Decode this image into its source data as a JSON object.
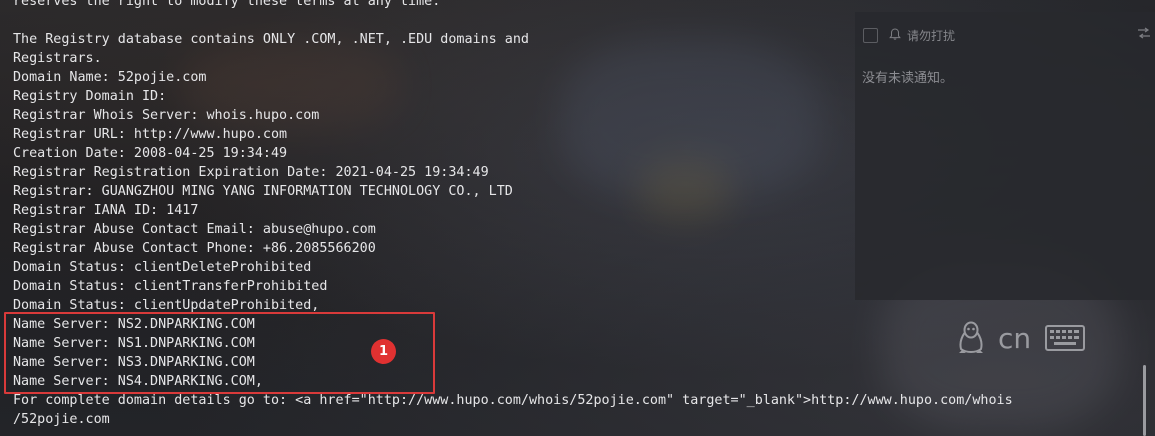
{
  "terminal": {
    "lines": [
      "reserves the right to modify these terms at any time.",
      "",
      "The Registry database contains ONLY .COM, .NET, .EDU domains and",
      "Registrars.",
      "Domain Name: 52pojie.com",
      "Registry Domain ID:",
      "Registrar Whois Server: whois.hupo.com",
      "Registrar URL: http://www.hupo.com",
      "Creation Date: 2008-04-25 19:34:49",
      "Registrar Registration Expiration Date: 2021-04-25 19:34:49",
      "Registrar: GUANGZHOU MING YANG INFORMATION TECHNOLOGY CO., LTD",
      "Registrar IANA ID: 1417",
      "Registrar Abuse Contact Email: abuse@hupo.com",
      "Registrar Abuse Contact Phone: +86.2085566200",
      "Domain Status: clientDeleteProhibited",
      "Domain Status: clientTransferProhibited",
      "Domain Status: clientUpdateProhibited,",
      "Name Server: NS2.DNPARKING.COM",
      "Name Server: NS1.DNPARKING.COM",
      "Name Server: NS3.DNPARKING.COM",
      "Name Server: NS4.DNPARKING.COM,",
      "For complete domain details go to: <a href=\"http://www.hupo.com/whois/52pojie.com\" target=\"_blank\">http://www.hupo.com/whois",
      "/52pojie.com"
    ]
  },
  "notifications": {
    "dnd_label": "请勿打扰",
    "empty_text": "没有未读通知。"
  },
  "tray": {
    "ime_label": "cn"
  },
  "annotation": {
    "marker_label": "1",
    "color": "#d93a3a"
  },
  "icons": {
    "bell": "bell-icon",
    "settings": "settings-icon",
    "penguin": "penguin-icon",
    "keyboard": "keyboard-icon"
  }
}
